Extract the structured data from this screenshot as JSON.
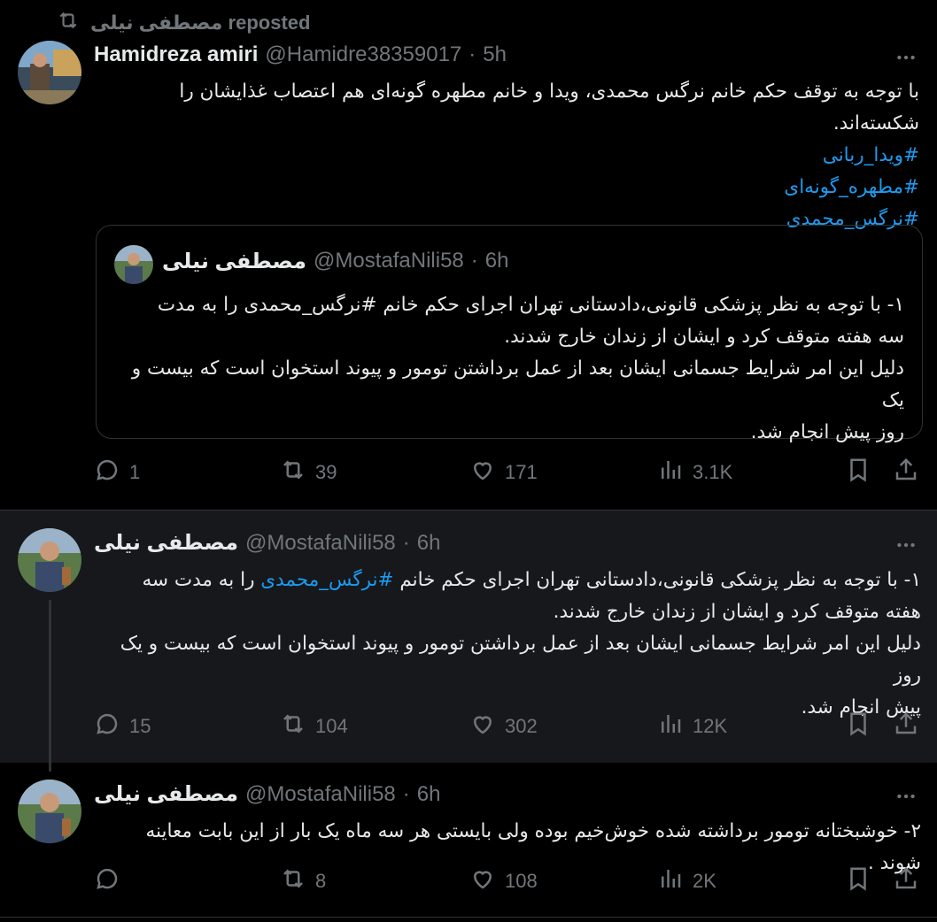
{
  "retweet": {
    "label": "مصطفی نیلی reposted"
  },
  "tweets": [
    {
      "author": "Hamidreza amiri",
      "handle": "@Hamidre38359017",
      "sep": "·",
      "time": "5h",
      "text_line1": "با توجه به توقف حکم خانم نرگس محمدی، ویدا و خانم مطهره گونه‌ای هم اعتصاب غذایشان را شکسته‌اند.",
      "hashtags": [
        "#ویدا_ربانی",
        "#مطهره_گونه‌ای",
        "#نرگس_محمدی"
      ],
      "quote": {
        "author": "مصطفی نیلی",
        "handle": "@MostafaNili58",
        "sep": "·",
        "time": "6h",
        "line1": "۱- با توجه به نظر پزشکی قانونی،دادستانی تهران اجرای حکم خانم #نرگس_محمدی را به مدت",
        "line2": "سه هفته متوقف کرد و ایشان از زندان خارج شدند.",
        "line3": "دلیل این امر شرایط جسمانی ایشان بعد از عمل برداشتن تومور و پیوند استخوان است که بیست و یک",
        "line4": "روز پیش انجام شد."
      },
      "replies": "1",
      "retweets": "39",
      "likes": "171",
      "views": "3.1K"
    },
    {
      "author": "مصطفی نیلی",
      "handle": "@MostafaNili58",
      "sep": "·",
      "time": "6h",
      "line1_pre": "۱- با توجه به نظر پزشکی قانونی،دادستانی تهران اجرای حکم خانم ",
      "line1_tag": "#نرگس_محمدی",
      "line1_post": " را به مدت سه",
      "line2": "هفته متوقف کرد و ایشان از زندان خارج شدند.",
      "line3": "دلیل این امر شرایط جسمانی ایشان بعد از عمل برداشتن تومور و پیوند استخوان است که بیست و یک روز",
      "line4": "پیش انجام شد.",
      "replies": "15",
      "retweets": "104",
      "likes": "302",
      "views": "12K"
    },
    {
      "author": "مصطفی نیلی",
      "handle": "@MostafaNili58",
      "sep": "·",
      "time": "6h",
      "line1": "۲- خوشبختانه تومور برداشته شده خوش‌خیم بوده  ولی بایستی هر سه ماه یک بار از این بابت معاینه شوند .",
      "replies": "",
      "retweets": "8",
      "likes": "108",
      "views": "2K"
    }
  ],
  "colors": {
    "background": "#000000",
    "text": "#e7e9ea",
    "muted": "#71767b",
    "link": "#1d9bf0",
    "border": "#2f3336"
  },
  "icons": [
    "retweet-icon",
    "reply-icon",
    "like-icon",
    "views-icon",
    "bookmark-icon",
    "share-icon",
    "more-icon"
  ]
}
